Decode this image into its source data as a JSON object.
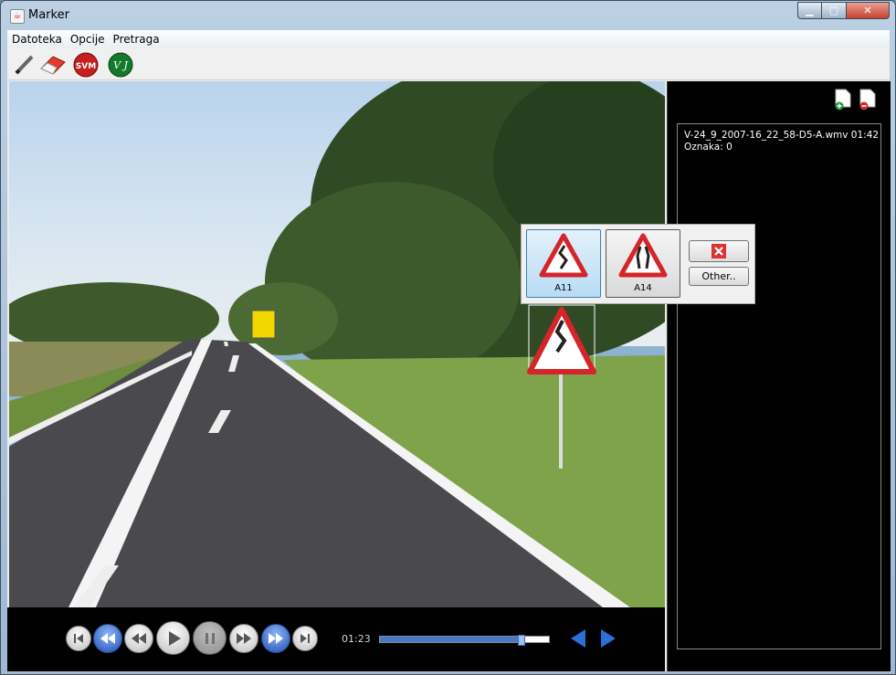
{
  "window": {
    "title": "Marker",
    "app_icon": "java-icon"
  },
  "menu": [
    "Datoteka",
    "Opcije",
    "Pretraga"
  ],
  "toolbar": {
    "tools": [
      "pencil-icon",
      "eraser-icon",
      "svm-icon",
      "vj-icon"
    ],
    "svm_text": "SVM",
    "vj_text": "V J"
  },
  "player": {
    "time": "01:23",
    "progress_fraction": 0.83
  },
  "sidebar": {
    "file_line": "V-24_9_2007-16_22_58-D5-A.wmv   01:42",
    "marks_line": "Oznaka: 0"
  },
  "popup": {
    "signs": [
      {
        "code": "A11"
      },
      {
        "code": "A14"
      }
    ],
    "other_label": "Other.."
  }
}
